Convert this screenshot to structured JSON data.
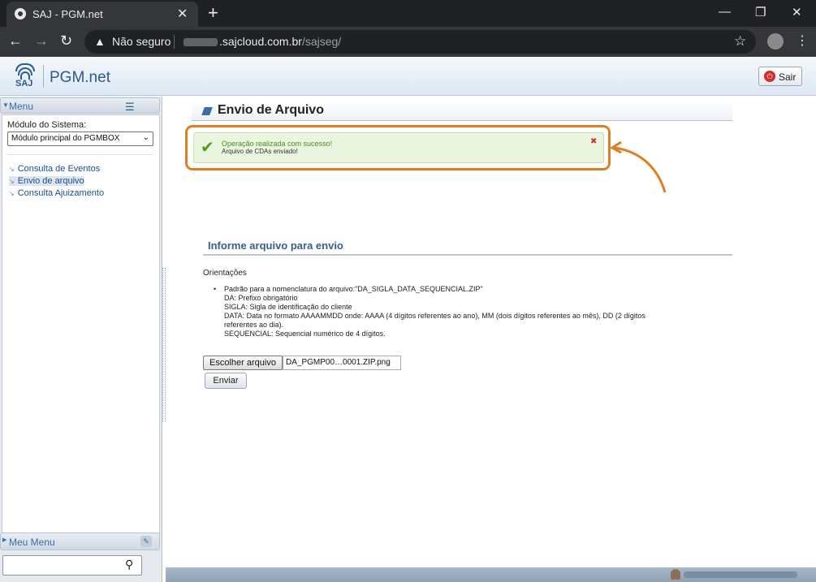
{
  "browser": {
    "tab_title": "SAJ - PGM.net",
    "tab_close": "✕",
    "new_tab": "+",
    "security_label": "Não seguro",
    "url_domain": ".sajcloud.com.br",
    "url_path": "/sajseg/",
    "icons": [
      "back-icon",
      "forward-icon",
      "reload-icon",
      "warning-icon",
      "star-icon",
      "profile-icon",
      "menu-kebab-icon"
    ]
  },
  "header": {
    "logo_text": "SAJ",
    "app_name": "PGM.net",
    "logout_label": "Sair",
    "logout_color": "#d62b2b"
  },
  "sidebar": {
    "menu_title": "Menu",
    "module_label": "Módulo do Sistema:",
    "module_selected": "Módulo principal do PGMBOX",
    "items": [
      {
        "label": "Consulta de Eventos"
      },
      {
        "label": "Envio de arquivo"
      },
      {
        "label": "Consulta Ajuizamento"
      }
    ],
    "my_menu_title": "Meu Menu"
  },
  "main": {
    "page_title": "Envio de Arquivo",
    "success_title": "Operação realizada com sucesso!",
    "success_detail": "Arquivo de CDAs enviado!",
    "success_color": "#4f9c1e",
    "section_title": "Informe arquivo para envio",
    "orientation_label": "Orientações",
    "orientation_lines": [
      "Padrão para a nomenclatura do arquivo:\"DA_SIGLA_DATA_SEQUENCIAL.ZIP\"",
      "DA: Prefixo obrigatório",
      "SIGLA: Sigla de identificação do cliente",
      "DATA: Data no formato AAAAMMDD onde: AAAA (4 dígitos referentes ao ano), MM (dois dígitos referentes ao mês), DD (2 dígitos",
      "referentes ao dia).",
      "SEQUENCIAL: Sequencial numérico de 4 dígitos."
    ],
    "choose_file_label": "Escolher arquivo",
    "chosen_file": "DA_PGMP00…0001.ZIP.png",
    "send_label": "Enviar",
    "annotation_color": "#e07f22"
  }
}
